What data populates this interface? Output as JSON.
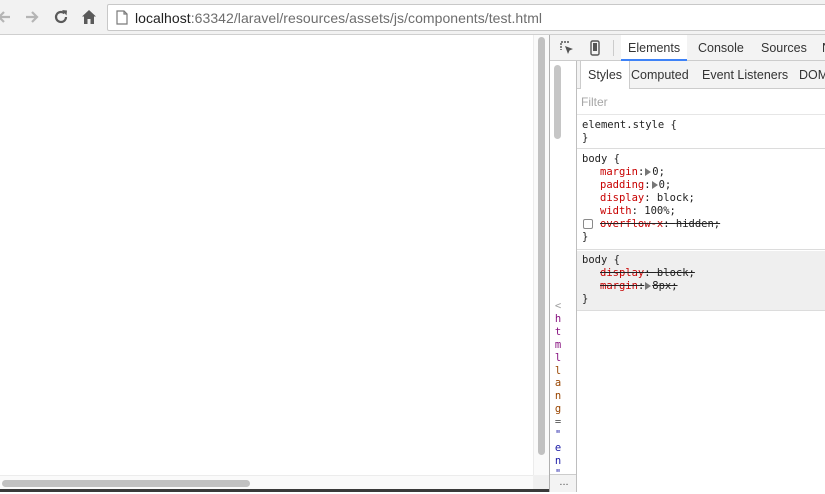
{
  "browser": {
    "url_host": "localhost",
    "url_path": ":63342/laravel/resources/assets/js/components/test.html",
    "icons": [
      "back-arrow-icon",
      "forward-arrow-icon",
      "reload-icon",
      "home-icon",
      "page-icon"
    ]
  },
  "devtools": {
    "tabs": [
      "Elements",
      "Console",
      "Sources",
      "N"
    ],
    "active_tab": "Elements",
    "accent_color": "#3e82f7",
    "dom_tree_chars": [
      "<",
      "h",
      "t",
      "m",
      "l",
      "l",
      "a",
      "n",
      "g",
      "=",
      "\"",
      "e",
      "n",
      "\"",
      ">"
    ],
    "dom_ellipsis": "...",
    "sidebar_tabs": [
      "Styles",
      "Computed",
      "Event Listeners",
      "DOM"
    ],
    "filter_placeholder": "Filter",
    "rules": {
      "element_style": {
        "selector": "element.style {",
        "close": "}"
      },
      "body_author": {
        "selector": "body {",
        "props": [
          {
            "name": "margin",
            "value": "0;"
          },
          {
            "name": "padding",
            "value": "0;"
          },
          {
            "name": "display",
            "value": "block;"
          },
          {
            "name": "width",
            "value": "100%;"
          },
          {
            "name": "overflow-x",
            "value": "hidden;"
          }
        ],
        "close": "}"
      },
      "body_ua": {
        "selector": "body {",
        "props": [
          {
            "name": "display",
            "value": "block;"
          },
          {
            "name": "margin",
            "value": "8px;"
          }
        ],
        "close": "}"
      }
    }
  }
}
